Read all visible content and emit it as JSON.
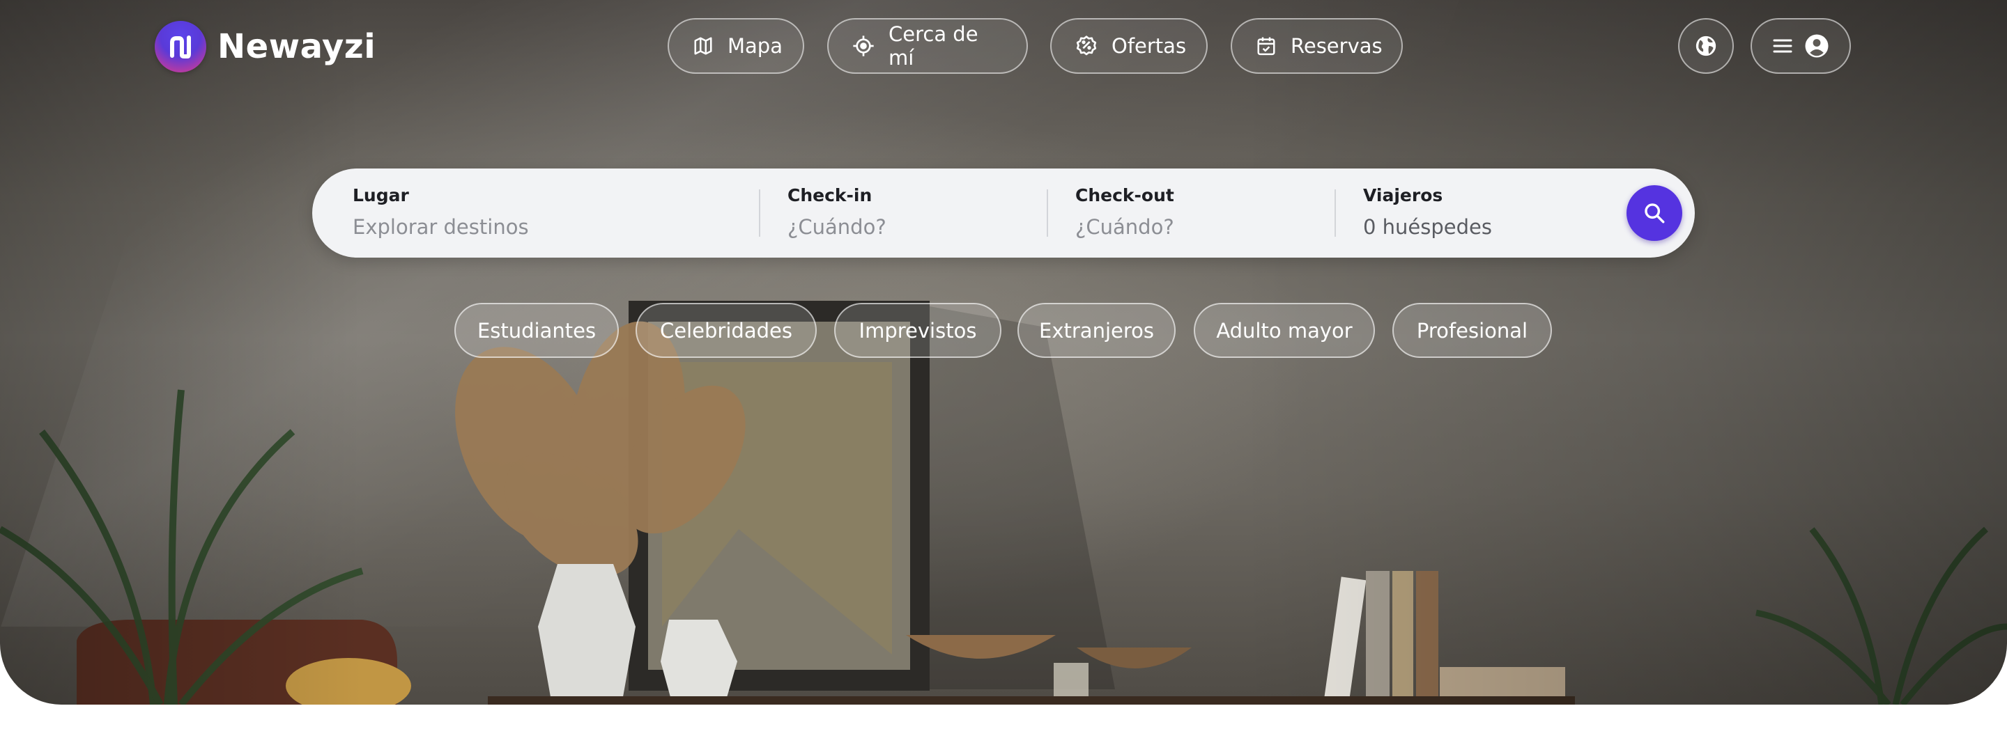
{
  "brand": {
    "name": "Newayzi",
    "accent": "#5533e0"
  },
  "nav": {
    "items": [
      {
        "label": "Mapa",
        "icon": "map-icon"
      },
      {
        "label": "Cerca de mí",
        "icon": "location-target-icon"
      },
      {
        "label": "Ofertas",
        "icon": "discount-badge-icon"
      },
      {
        "label": "Reservas",
        "icon": "calendar-check-icon"
      }
    ],
    "language_icon": "globe-icon",
    "menu_icon": "hamburger-menu-icon",
    "account_icon": "user-circle-icon"
  },
  "search": {
    "lugar": {
      "label": "Lugar",
      "placeholder": "Explorar destinos"
    },
    "checkin": {
      "label": "Check-in",
      "placeholder": "¿Cuándo?"
    },
    "checkout": {
      "label": "Check-out",
      "placeholder": "¿Cuándo?"
    },
    "viajeros": {
      "label": "Viajeros",
      "value": "0 huéspedes"
    },
    "button_icon": "search-icon"
  },
  "categories": [
    "Estudiantes",
    "Celebridades",
    "Imprevistos",
    "Extranjeros",
    "Adulto mayor",
    "Profesional"
  ]
}
